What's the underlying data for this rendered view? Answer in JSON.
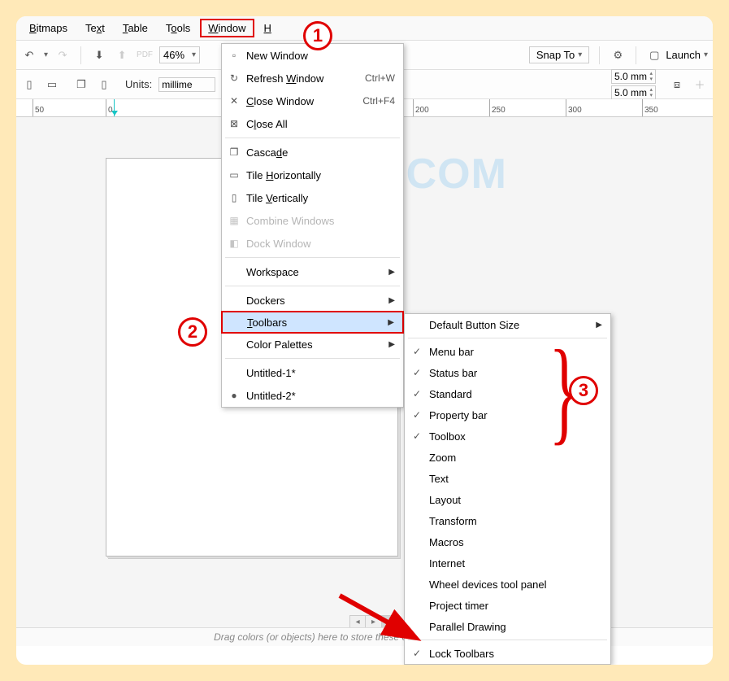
{
  "menubar": {
    "items": [
      "Bitmaps",
      "Text",
      "Table",
      "Tools",
      "Window",
      "H"
    ]
  },
  "toolbar1": {
    "zoom": "46%",
    "snap": "Snap To",
    "launch": "Launch"
  },
  "toolbar2": {
    "unitsLabel": "Units:",
    "unitsValue": "millime",
    "dim1": "5.0 mm",
    "dim2": "5.0 mm"
  },
  "ruler": {
    "ticks": [
      "50",
      "0",
      "200",
      "250",
      "300",
      "350"
    ]
  },
  "watermark": "ZOTUTORIAL.COM",
  "windowMenu": {
    "items": [
      {
        "label": "New Window",
        "icon": "▫",
        "shortcut": ""
      },
      {
        "label": "Refresh Window",
        "icon": "↻",
        "shortcut": "Ctrl+W"
      },
      {
        "label": "Close Window",
        "icon": "✕",
        "shortcut": "Ctrl+F4"
      },
      {
        "label": "Close All",
        "icon": "⊠",
        "shortcut": ""
      }
    ],
    "arrange": [
      {
        "label": "Cascade",
        "icon": "❐"
      },
      {
        "label": "Tile Horizontally",
        "icon": "▭"
      },
      {
        "label": "Tile Vertically",
        "icon": "▯"
      },
      {
        "label": "Combine Windows",
        "icon": "▦",
        "disabled": true
      },
      {
        "label": "Dock Window",
        "icon": "◧",
        "disabled": true
      }
    ],
    "sub": [
      {
        "label": "Workspace"
      },
      {
        "label": "Dockers"
      },
      {
        "label": "Toolbars",
        "hl": true
      },
      {
        "label": "Color Palettes"
      }
    ],
    "docs": [
      {
        "label": "Untitled-1*",
        "active": false
      },
      {
        "label": "Untitled-2*",
        "active": true
      }
    ]
  },
  "toolbarsMenu": {
    "head": {
      "label": "Default Button Size"
    },
    "items": [
      {
        "label": "Menu bar",
        "checked": true
      },
      {
        "label": "Status bar",
        "checked": true
      },
      {
        "label": "Standard",
        "checked": true
      },
      {
        "label": "Property bar",
        "checked": true
      },
      {
        "label": "Toolbox",
        "checked": true
      },
      {
        "label": "Zoom",
        "checked": false
      },
      {
        "label": "Text",
        "checked": false
      },
      {
        "label": "Layout",
        "checked": false
      },
      {
        "label": "Transform",
        "checked": false
      },
      {
        "label": "Macros",
        "checked": false
      },
      {
        "label": "Internet",
        "checked": false
      },
      {
        "label": "Wheel devices tool panel",
        "checked": false
      },
      {
        "label": "Project timer",
        "checked": false
      },
      {
        "label": "Parallel Drawing",
        "checked": false
      }
    ],
    "lock": {
      "label": "Lock Toolbars",
      "checked": true
    }
  },
  "statusHint": "Drag colors (or objects) here to store these colors with your document",
  "annotations": {
    "n1": "1",
    "n2": "2",
    "n3": "3"
  }
}
